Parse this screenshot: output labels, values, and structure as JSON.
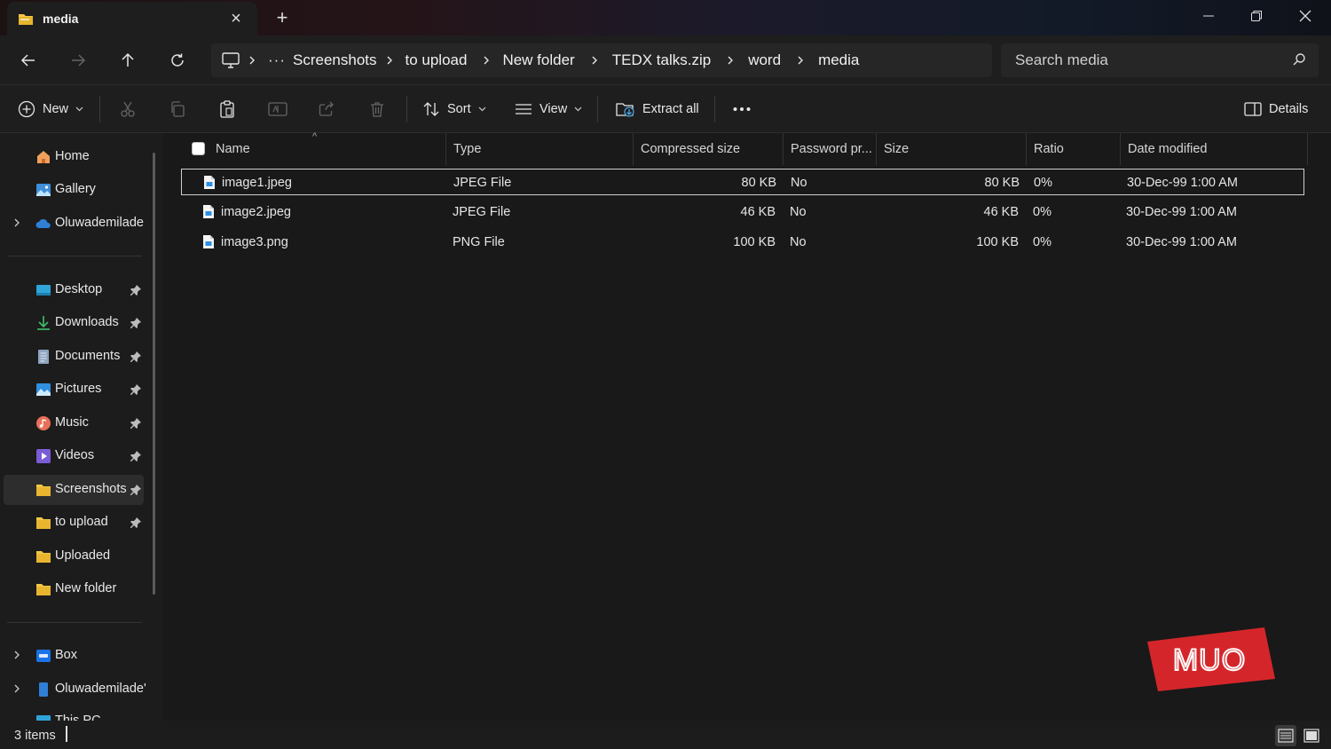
{
  "tab": {
    "title": "media"
  },
  "breadcrumb": [
    "Screenshots",
    "to upload",
    "New folder",
    "TEDX talks.zip",
    "word",
    "media"
  ],
  "search": {
    "placeholder": "Search media"
  },
  "toolbar": {
    "new_label": "New",
    "sort_label": "Sort",
    "view_label": "View",
    "extract_label": "Extract all",
    "details_label": "Details"
  },
  "sidebar": {
    "top": [
      {
        "label": "Home",
        "icon": "home-icon"
      },
      {
        "label": "Gallery",
        "icon": "gallery-icon"
      },
      {
        "label": "Oluwademilade",
        "icon": "cloud-icon"
      }
    ],
    "pinned": [
      {
        "label": "Desktop",
        "icon": "desktop-icon"
      },
      {
        "label": "Downloads",
        "icon": "download-icon"
      },
      {
        "label": "Documents",
        "icon": "document-icon"
      },
      {
        "label": "Pictures",
        "icon": "pictures-icon"
      },
      {
        "label": "Music",
        "icon": "music-icon"
      },
      {
        "label": "Videos",
        "icon": "videos-icon"
      },
      {
        "label": "Screenshots",
        "icon": "folder-icon"
      },
      {
        "label": "to upload",
        "icon": "folder-icon"
      },
      {
        "label": "Uploaded",
        "icon": "folder-icon"
      },
      {
        "label": "New folder",
        "icon": "folder-icon"
      }
    ],
    "bottom": [
      {
        "label": "Box",
        "icon": "box-icon"
      },
      {
        "label": "Oluwademilade'",
        "icon": "device-icon"
      },
      {
        "label": "This PC",
        "icon": "pc-icon"
      }
    ]
  },
  "columns": [
    "Name",
    "Type",
    "Compressed size",
    "Password pr...",
    "Size",
    "Ratio",
    "Date modified"
  ],
  "files": [
    {
      "name": "image1.jpeg",
      "type": "JPEG File",
      "compressed": "80 KB",
      "password": "No",
      "size": "80 KB",
      "ratio": "0%",
      "date": "30-Dec-99 1:00 AM"
    },
    {
      "name": "image2.jpeg",
      "type": "JPEG File",
      "compressed": "46 KB",
      "password": "No",
      "size": "46 KB",
      "ratio": "0%",
      "date": "30-Dec-99 1:00 AM"
    },
    {
      "name": "image3.png",
      "type": "PNG File",
      "compressed": "100 KB",
      "password": "No",
      "size": "100 KB",
      "ratio": "0%",
      "date": "30-Dec-99 1:00 AM"
    }
  ],
  "status": {
    "count": "3 items"
  },
  "watermark": {
    "text": "MUO",
    "color": "#d4262a"
  },
  "colors": {
    "accent": "#4fa3e0",
    "folder": "#f2c744"
  }
}
